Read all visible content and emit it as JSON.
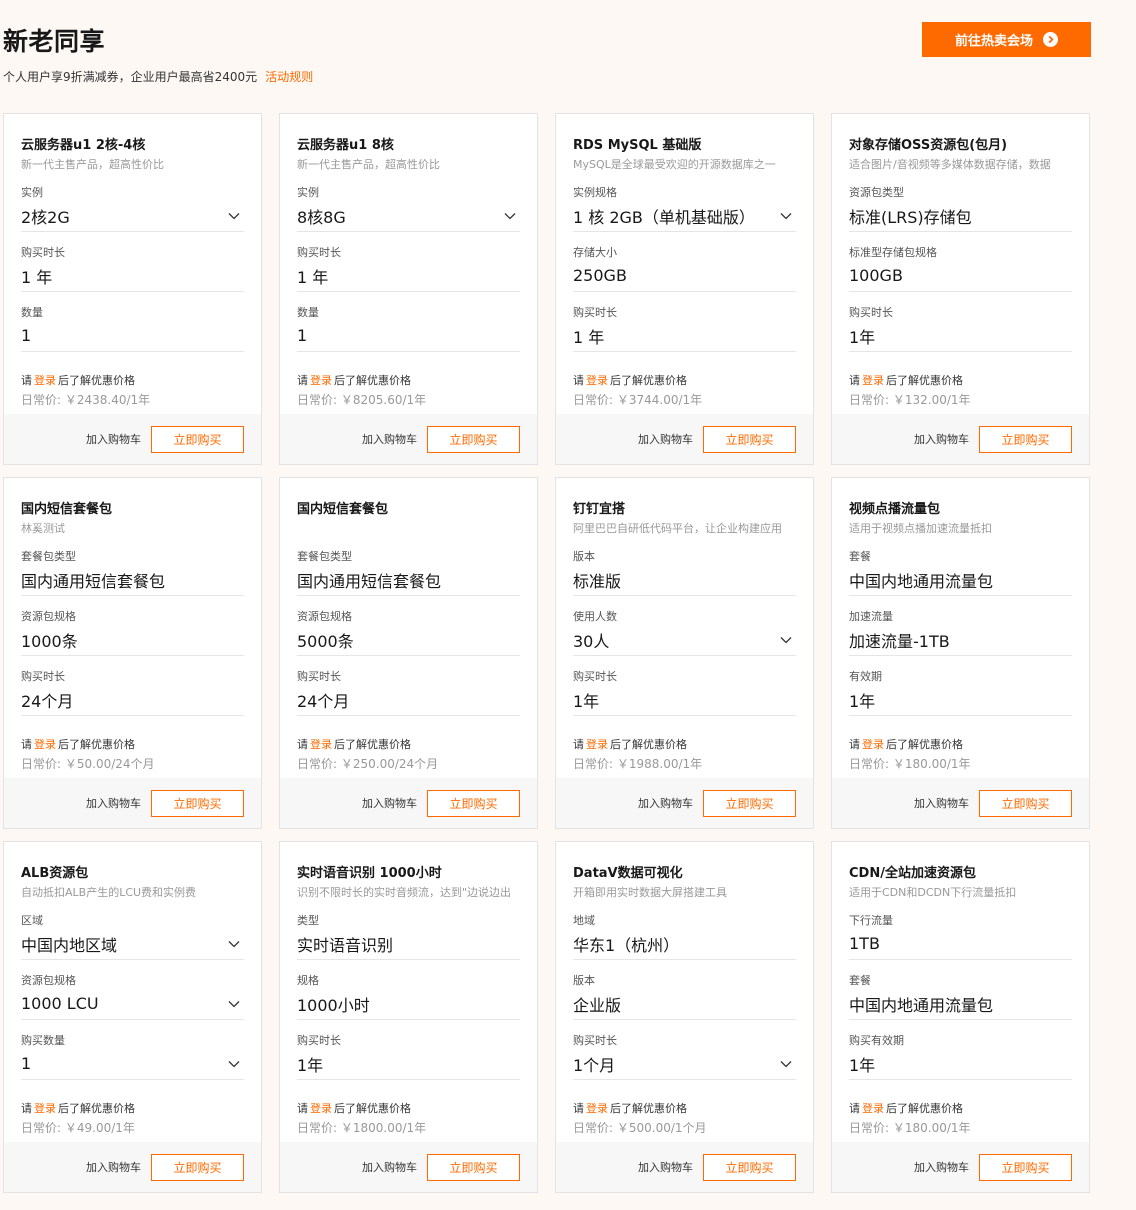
{
  "header": {
    "title": "新老同享",
    "subtitle": "个人用户享9折满减券，企业用户最高省2400元",
    "rules_link": "活动规则",
    "hot_button": "前往热卖会场"
  },
  "common": {
    "login_prefix": "请",
    "login_link": "登录",
    "login_suffix": "后了解优惠价格",
    "cart_label": "加入购物车",
    "buy_label": "立即购买"
  },
  "cards": [
    {
      "title": "云服务器u1 2核-4核",
      "desc": "新一代主售产品，超高性价比",
      "fields": [
        {
          "label": "实例",
          "value": "2核2G",
          "dropdown": true
        },
        {
          "label": "购买时长",
          "value": "1 年",
          "dropdown": false
        },
        {
          "label": "数量",
          "value": "1",
          "dropdown": false
        }
      ],
      "price": "日常价: ￥2438.40/1年"
    },
    {
      "title": "云服务器u1 8核",
      "desc": "新一代主售产品，超高性价比",
      "fields": [
        {
          "label": "实例",
          "value": "8核8G",
          "dropdown": true
        },
        {
          "label": "购买时长",
          "value": "1 年",
          "dropdown": false
        },
        {
          "label": "数量",
          "value": "1",
          "dropdown": false
        }
      ],
      "price": "日常价: ￥8205.60/1年"
    },
    {
      "title": "RDS MySQL 基础版",
      "desc": "MySQL是全球最受欢迎的开源数据库之一",
      "fields": [
        {
          "label": "实例规格",
          "value": "1 核 2GB（单机基础版）",
          "dropdown": true
        },
        {
          "label": "存储大小",
          "value": "250GB",
          "dropdown": false
        },
        {
          "label": "购买时长",
          "value": "1 年",
          "dropdown": false
        }
      ],
      "price": "日常价: ￥3744.00/1年"
    },
    {
      "title": "对象存储OSS资源包(包月)",
      "desc": "适合图片/音视频等多媒体数据存储，数据",
      "fields": [
        {
          "label": "资源包类型",
          "value": "标准(LRS)存储包",
          "dropdown": false
        },
        {
          "label": "标准型存储包规格",
          "value": "100GB",
          "dropdown": false
        },
        {
          "label": "购买时长",
          "value": "1年",
          "dropdown": false
        }
      ],
      "price": "日常价: ￥132.00/1年"
    },
    {
      "title": "国内短信套餐包",
      "desc": "林奚测试",
      "fields": [
        {
          "label": "套餐包类型",
          "value": "国内通用短信套餐包",
          "dropdown": false
        },
        {
          "label": "资源包规格",
          "value": "1000条",
          "dropdown": false
        },
        {
          "label": "购买时长",
          "value": "24个月",
          "dropdown": false
        }
      ],
      "price": "日常价: ￥50.00/24个月"
    },
    {
      "title": "国内短信套餐包",
      "desc": "",
      "fields": [
        {
          "label": "套餐包类型",
          "value": "国内通用短信套餐包",
          "dropdown": false
        },
        {
          "label": "资源包规格",
          "value": "5000条",
          "dropdown": false
        },
        {
          "label": "购买时长",
          "value": "24个月",
          "dropdown": false
        }
      ],
      "price": "日常价: ￥250.00/24个月"
    },
    {
      "title": "钉钉宜搭",
      "desc": "阿里巴巴自研低代码平台，让企业构建应用",
      "fields": [
        {
          "label": "版本",
          "value": "标准版",
          "dropdown": false
        },
        {
          "label": "使用人数",
          "value": "30人",
          "dropdown": true
        },
        {
          "label": "购买时长",
          "value": "1年",
          "dropdown": false
        }
      ],
      "price": "日常价: ￥1988.00/1年"
    },
    {
      "title": "视频点播流量包",
      "desc": "适用于视频点播加速流量抵扣",
      "fields": [
        {
          "label": "套餐",
          "value": "中国内地通用流量包",
          "dropdown": false
        },
        {
          "label": "加速流量",
          "value": "加速流量-1TB",
          "dropdown": false
        },
        {
          "label": "有效期",
          "value": "1年",
          "dropdown": false
        }
      ],
      "price": "日常价: ￥180.00/1年"
    },
    {
      "title": "ALB资源包",
      "desc": "自动抵扣ALB产生的LCU费和实例费",
      "fields": [
        {
          "label": "区域",
          "value": "中国内地区域",
          "dropdown": true
        },
        {
          "label": "资源包规格",
          "value": "1000 LCU",
          "dropdown": true
        },
        {
          "label": "购买数量",
          "value": "1",
          "dropdown": true
        }
      ],
      "price": "日常价: ￥49.00/1年"
    },
    {
      "title": "实时语音识别 1000小时",
      "desc": "识别不限时长的实时音频流，达到\"边说边出",
      "fields": [
        {
          "label": "类型",
          "value": "实时语音识别",
          "dropdown": false
        },
        {
          "label": "规格",
          "value": "1000小时",
          "dropdown": false
        },
        {
          "label": "购买时长",
          "value": "1年",
          "dropdown": false
        }
      ],
      "price": "日常价: ￥1800.00/1年"
    },
    {
      "title": "DataV数据可视化",
      "desc": "开箱即用实时数据大屏搭建工具",
      "fields": [
        {
          "label": "地域",
          "value": "华东1（杭州）",
          "dropdown": false
        },
        {
          "label": "版本",
          "value": "企业版",
          "dropdown": false
        },
        {
          "label": "购买时长",
          "value": "1个月",
          "dropdown": true
        }
      ],
      "price": "日常价: ￥500.00/1个月"
    },
    {
      "title": "CDN/全站加速资源包",
      "desc": "适用于CDN和DCDN下行流量抵扣",
      "fields": [
        {
          "label": "下行流量",
          "value": "1TB",
          "dropdown": false
        },
        {
          "label": "套餐",
          "value": "中国内地通用流量包",
          "dropdown": false
        },
        {
          "label": "购买有效期",
          "value": "1年",
          "dropdown": false
        }
      ],
      "price": "日常价: ￥180.00/1年"
    }
  ]
}
